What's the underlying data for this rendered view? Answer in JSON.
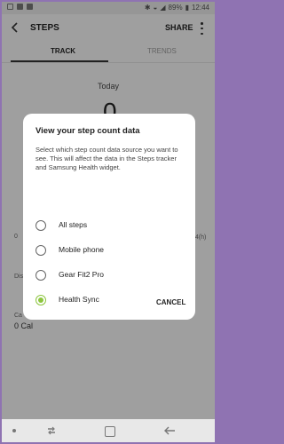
{
  "status_bar": {
    "time": "12:44",
    "battery": "89%"
  },
  "app_bar": {
    "title": "STEPS",
    "share_label": "SHARE"
  },
  "tabs": [
    {
      "label": "TRACK",
      "active": true
    },
    {
      "label": "TRENDS",
      "active": false
    }
  ],
  "background": {
    "today_label": "Today",
    "step_count": "0",
    "chart_start_tick": "0",
    "chart_end_tick": "24(h)",
    "distance_label_partial": "Dis",
    "calories_label_partial": "Ca",
    "calories_value": "0 Cal"
  },
  "dialog": {
    "title": "View your step count data",
    "description": "Select which step count data source you want to see. This will affect the data in the Steps tracker and Samsung Health widget.",
    "options": [
      {
        "label": "All steps",
        "selected": false
      },
      {
        "label": "Mobile phone",
        "selected": false
      },
      {
        "label": "Gear Fit2 Pro",
        "selected": false
      },
      {
        "label": "Health Sync",
        "selected": true
      }
    ],
    "cancel_label": "CANCEL"
  },
  "colors": {
    "accent": "#8dc63f",
    "border_frame": "#8f73b2"
  }
}
